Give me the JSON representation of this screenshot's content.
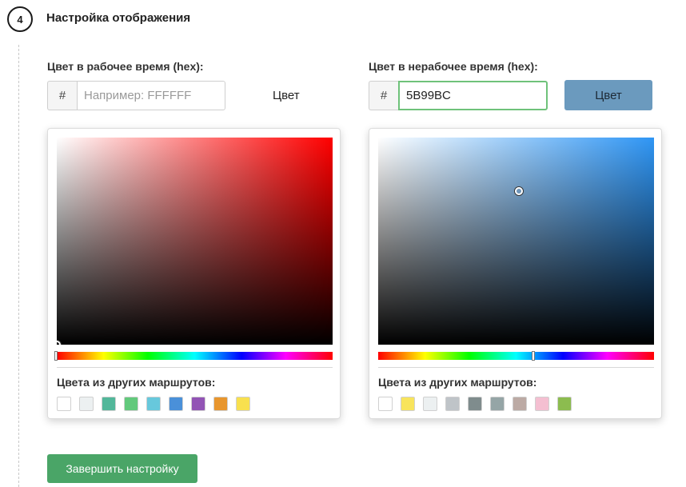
{
  "step": {
    "number": "4",
    "title": "Настройка отображения"
  },
  "work_time": {
    "label": "Цвет в рабочее время (hex):",
    "prefix": "#",
    "value": "",
    "placeholder": "Например: FFFFFF",
    "color_button_label": "Цвет",
    "picker": {
      "hue_color": "#ff0000",
      "others_label": "Цвета из других маршрутов:",
      "swatches": [
        "#ffffff",
        "#ecf0f1",
        "#52b79a",
        "#62c97c",
        "#67c8dc",
        "#4a90d9",
        "#9254b5",
        "#e8962e",
        "#f8e04e"
      ]
    }
  },
  "off_time": {
    "label": "Цвет в нерабочее время (hex):",
    "prefix": "#",
    "value": "5B99BC",
    "placeholder": "Например: FFFFFF",
    "color_button_label": "Цвет",
    "color_button_bg": "#6b9abe",
    "picker": {
      "hue_color": "#2f96f5",
      "others_label": "Цвета из других маршрутов:",
      "swatches": [
        "#ffffff",
        "#f8e45c",
        "#ecf0f1",
        "#bfc4c8",
        "#7f8c8d",
        "#95a5a6",
        "#bcaaa4",
        "#f4bfd1",
        "#8cbc4f"
      ]
    }
  },
  "finish_button_label": "Завершить настройку",
  "colors": {
    "accent_green": "#4aa567",
    "active_border": "#6fc27a"
  }
}
